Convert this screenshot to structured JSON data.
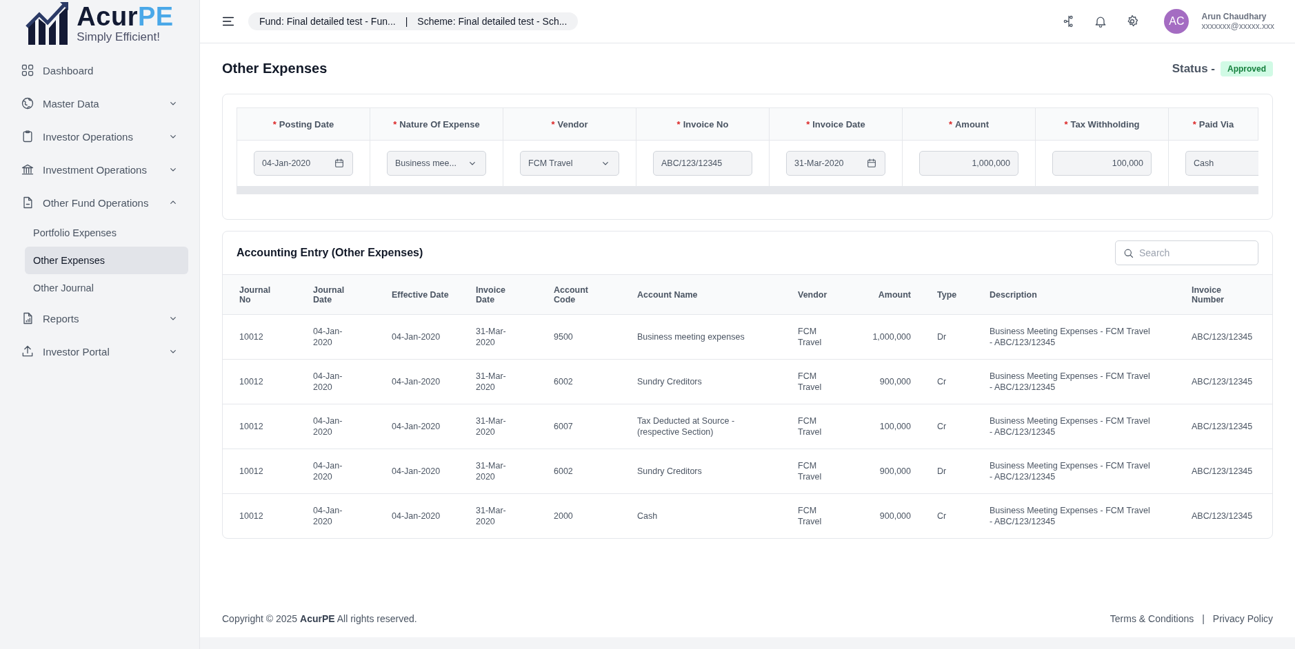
{
  "brand": {
    "name_main": "Acur",
    "name_accent": "PE",
    "tagline": "Simply Efficient!"
  },
  "sidebar": {
    "items": [
      {
        "label": "Dashboard",
        "kind": "link"
      },
      {
        "label": "Master Data",
        "kind": "group",
        "expanded": false
      },
      {
        "label": "Investor Operations",
        "kind": "group",
        "expanded": false
      },
      {
        "label": "Investment Operations",
        "kind": "group",
        "expanded": false
      },
      {
        "label": "Other Fund Operations",
        "kind": "group",
        "expanded": true,
        "children": [
          {
            "label": "Portfolio Expenses",
            "selected": false
          },
          {
            "label": "Other Expenses",
            "selected": true
          },
          {
            "label": "Other Journal",
            "selected": false
          }
        ]
      },
      {
        "label": "Reports",
        "kind": "group",
        "expanded": false
      },
      {
        "label": "Investor Portal",
        "kind": "group",
        "expanded": false
      }
    ]
  },
  "header": {
    "breadcrumb": [
      "Fund: Final detailed test - Fun...",
      "|",
      "Scheme: Final detailed test - Sch..."
    ],
    "user": {
      "initials": "AC",
      "name": "Arun Chaudhary",
      "email": "xxxxxxx@xxxxx.xxx"
    }
  },
  "page": {
    "title": "Other Expenses",
    "status_label": "Status -",
    "status": "Approved"
  },
  "form": {
    "columns": [
      {
        "label": "Posting Date",
        "required_mark": "*"
      },
      {
        "label": "Nature Of Expense",
        "required_mark": "*"
      },
      {
        "label": "Vendor",
        "required_mark": "*"
      },
      {
        "label": "Invoice No",
        "required_mark": "*"
      },
      {
        "label": "Invoice Date",
        "required_mark": "*"
      },
      {
        "label": "Amount",
        "required_mark": "*"
      },
      {
        "label": "Tax Withholding",
        "required_mark": "*"
      },
      {
        "label": "Paid Via",
        "required_mark": "*"
      }
    ],
    "fields": [
      {
        "kind": "date",
        "value": "04-Jan-2020"
      },
      {
        "kind": "select",
        "value": "Business mee..."
      },
      {
        "kind": "select",
        "value": "FCM Travel"
      },
      {
        "kind": "text",
        "value": "ABC/123/12345"
      },
      {
        "kind": "date",
        "value": "31-Mar-2020"
      },
      {
        "kind": "number",
        "value": "1,000,000"
      },
      {
        "kind": "number",
        "value": "100,000"
      },
      {
        "kind": "text",
        "value": "Cash"
      }
    ]
  },
  "accounting": {
    "title": "Accounting Entry (Other Expenses)",
    "search": {
      "placeholder": "Search"
    },
    "columns": [
      "Journal No",
      "Journal Date",
      "Effective Date",
      "Invoice Date",
      "Account Code",
      "Account Name",
      "Vendor",
      "Amount",
      "Type",
      "Description",
      "Invoice Number"
    ],
    "rows": [
      [
        "10012",
        "04-Jan-2020",
        "04-Jan-2020",
        "31-Mar-2020",
        "9500",
        "Business meeting expenses",
        "FCM Travel",
        "1,000,000",
        "Dr",
        "Business Meeting Expenses - FCM Travel - ABC/123/12345",
        "ABC/123/12345"
      ],
      [
        "10012",
        "04-Jan-2020",
        "04-Jan-2020",
        "31-Mar-2020",
        "6002",
        "Sundry Creditors",
        "FCM Travel",
        "900,000",
        "Cr",
        "Business Meeting Expenses - FCM Travel - ABC/123/12345",
        "ABC/123/12345"
      ],
      [
        "10012",
        "04-Jan-2020",
        "04-Jan-2020",
        "31-Mar-2020",
        "6007",
        "Tax Deducted at Source - (respective Section)",
        "FCM Travel",
        "100,000",
        "Cr",
        "Business Meeting Expenses - FCM Travel - ABC/123/12345",
        "ABC/123/12345"
      ],
      [
        "10012",
        "04-Jan-2020",
        "04-Jan-2020",
        "31-Mar-2020",
        "6002",
        "Sundry Creditors",
        "FCM Travel",
        "900,000",
        "Dr",
        "Business Meeting Expenses - FCM Travel - ABC/123/12345",
        "ABC/123/12345"
      ],
      [
        "10012",
        "04-Jan-2020",
        "04-Jan-2020",
        "31-Mar-2020",
        "2000",
        "Cash",
        "FCM Travel",
        "900,000",
        "Cr",
        "Business Meeting Expenses - FCM Travel - ABC/123/12345",
        "ABC/123/12345"
      ]
    ]
  },
  "footer": {
    "copyright": "Copyright © 2025 **AcurPE** All rights reserved.",
    "links": [
      "Terms & Conditions",
      "Privacy Policy"
    ],
    "separator": "|"
  }
}
